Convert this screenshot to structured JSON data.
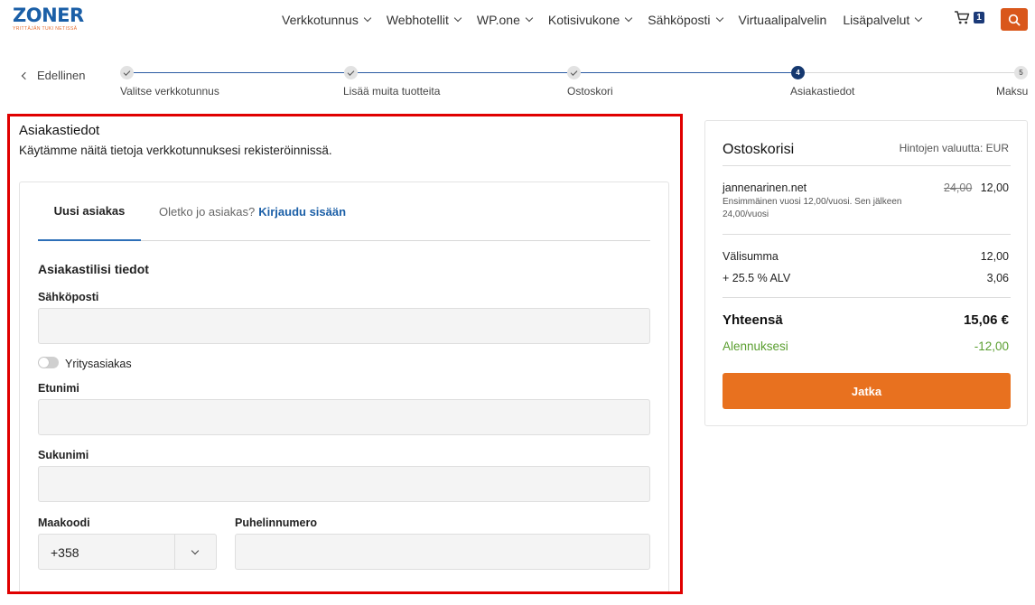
{
  "logo": {
    "name": "ZONER",
    "tagline": "YRITTÄJÄN TUKI NETISSÄ"
  },
  "nav": {
    "items": [
      {
        "label": "Verkkotunnus",
        "has_menu": true
      },
      {
        "label": "Webhotellit",
        "has_menu": true
      },
      {
        "label": "WP.one",
        "has_menu": true
      },
      {
        "label": "Kotisivukone",
        "has_menu": true
      },
      {
        "label": "Sähköposti",
        "has_menu": true
      },
      {
        "label": "Virtuaalipalvelin",
        "has_menu": false
      },
      {
        "label": "Lisäpalvelut",
        "has_menu": true
      }
    ],
    "cart_count": "1",
    "cart_icon": "shopping-cart-icon",
    "search_icon": "search-icon"
  },
  "stepper": {
    "back_label": "Edellinen",
    "steps": [
      {
        "label": "Valitse verkkotunnus",
        "state": "done",
        "marker": ""
      },
      {
        "label": "Lisää muita tuotteita",
        "state": "done",
        "marker": ""
      },
      {
        "label": "Ostoskori",
        "state": "done",
        "marker": ""
      },
      {
        "label": "Asiakastiedot",
        "state": "active",
        "marker": "4"
      },
      {
        "label": "Maksu",
        "state": "pending",
        "marker": "5"
      }
    ]
  },
  "form": {
    "title": "Asiakastiedot",
    "description": "Käytämme näitä tietoja verkkotunnuksesi rekisteröinnissä.",
    "tabs": {
      "new_customer": "Uusi asiakas",
      "existing_prompt": "Oletko jo asiakas?",
      "login_link": "Kirjaudu sisään"
    },
    "section_title": "Asiakastilisi tiedot",
    "email_label": "Sähköposti",
    "email_value": "",
    "company_toggle_label": "Yritysasiakas",
    "company_toggle_on": false,
    "firstname_label": "Etunimi",
    "firstname_value": "",
    "lastname_label": "Sukunimi",
    "lastname_value": "",
    "country_code_label": "Maakoodi",
    "country_code_value": "+358",
    "phone_label": "Puhelinnumero",
    "phone_value": ""
  },
  "cart": {
    "title": "Ostoskorisi",
    "currency_note": "Hintojen valuutta: EUR",
    "item": {
      "name": "jannenarinen.net",
      "old_price": "24,00",
      "price": "12,00",
      "note": "Ensimmäinen vuosi 12,00/vuosi. Sen jälkeen 24,00/vuosi"
    },
    "subtotal_label": "Välisumma",
    "subtotal": "12,00",
    "vat_label": "+ 25.5 % ALV",
    "vat": "3,06",
    "total_label": "Yhteensä",
    "total": "15,06 €",
    "discount_label": "Alennuksesi",
    "discount": "-12,00",
    "continue_label": "Jatka"
  },
  "colors": {
    "brand_blue": "#1b5fa7",
    "accent_orange": "#e8711f",
    "highlight_red": "#e00000",
    "discount_green": "#5a9e2f"
  }
}
